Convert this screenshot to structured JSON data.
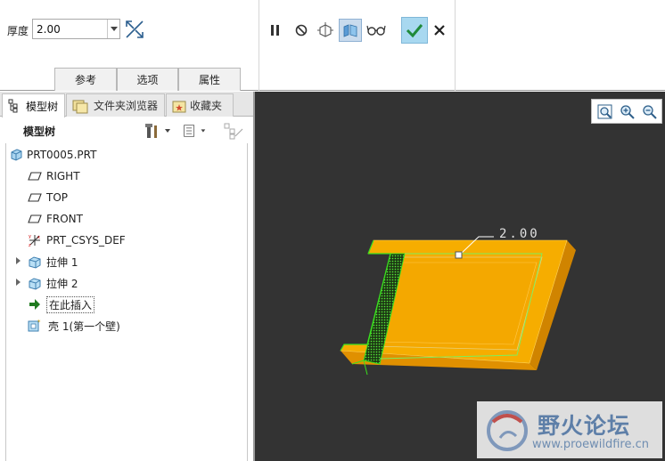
{
  "dashboard": {
    "thickness_label": "厚度",
    "thickness_value": "2.00",
    "tabs": [
      "参考",
      "选项",
      "属性"
    ]
  },
  "navigator": {
    "tabs": [
      "模型树",
      "文件夹浏览器",
      "收藏夹"
    ],
    "tree_title": "模型树",
    "items": [
      {
        "label": "PRT0005.PRT",
        "icon": "part-icon"
      },
      {
        "label": "RIGHT",
        "icon": "datum-plane-icon"
      },
      {
        "label": "TOP",
        "icon": "datum-plane-icon"
      },
      {
        "label": "FRONT",
        "icon": "datum-plane-icon"
      },
      {
        "label": "PRT_CSYS_DEF",
        "icon": "csys-icon"
      },
      {
        "label": "拉伸 1",
        "icon": "extrude-icon"
      },
      {
        "label": "拉伸 2",
        "icon": "extrude-icon"
      },
      {
        "label": "在此插入",
        "icon": "insert-here-arrow-icon"
      },
      {
        "label": "壳 1(第一个壁)",
        "icon": "shell-icon"
      }
    ]
  },
  "graphics": {
    "dimension": "2.00",
    "watermark_cn": "野火论坛",
    "watermark_url": "www.proewildfire.cn"
  },
  "colors": {
    "accent_selection": "#c9dbed",
    "ok_button": "#a8d8f0",
    "part_face": "#f5ab00",
    "shell_preview": "#39e01e",
    "background": "#333333"
  }
}
